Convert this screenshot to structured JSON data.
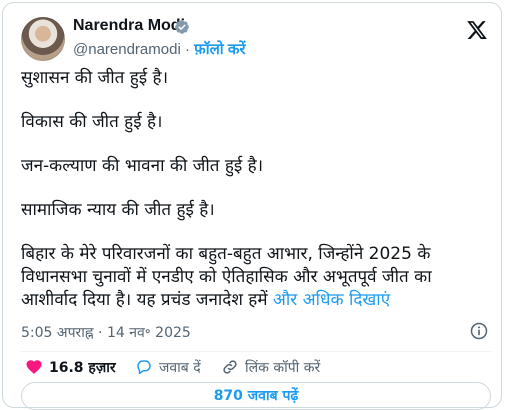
{
  "author": {
    "name": "Narendra Modi",
    "handle": "@narendramodi",
    "separator": "·",
    "follow_label": "फ़ॉलो करें"
  },
  "tweet": {
    "paragraphs": [
      "सुशासन की जीत हुई है।",
      "विकास की जीत हुई है।",
      "जन-कल्याण की भावना की जीत हुई है।",
      "सामाजिक न्याय की जीत हुई है।"
    ],
    "last_paragraph": "बिहार के मेरे परिवारजनों का बहुत-बहुत आभार, जिन्होंने 2025 के विधानसभा चुनावों में एनडीए को ऐतिहासिक और अभूतपूर्व जीत का आशीर्वाद दिया है। यह प्रचंड जनादेश हमें",
    "show_more": "और अधिक दिखाएं"
  },
  "meta": {
    "timestamp": "5:05 अपराह्न · 14 नव॰ 2025"
  },
  "actions": {
    "likes": "16.8 हज़ार",
    "reply": "जवाब दें",
    "copy_link": "लिंक कॉपी करें"
  },
  "replies_button": "870 जवाब पढ़ें",
  "colors": {
    "accent": "#1d9bf0",
    "like": "#f91880",
    "text": "#0f1419",
    "muted": "#536471"
  },
  "icons": [
    "verified-badge-icon",
    "x-logo-icon",
    "info-icon",
    "heart-icon",
    "reply-icon",
    "link-icon"
  ]
}
